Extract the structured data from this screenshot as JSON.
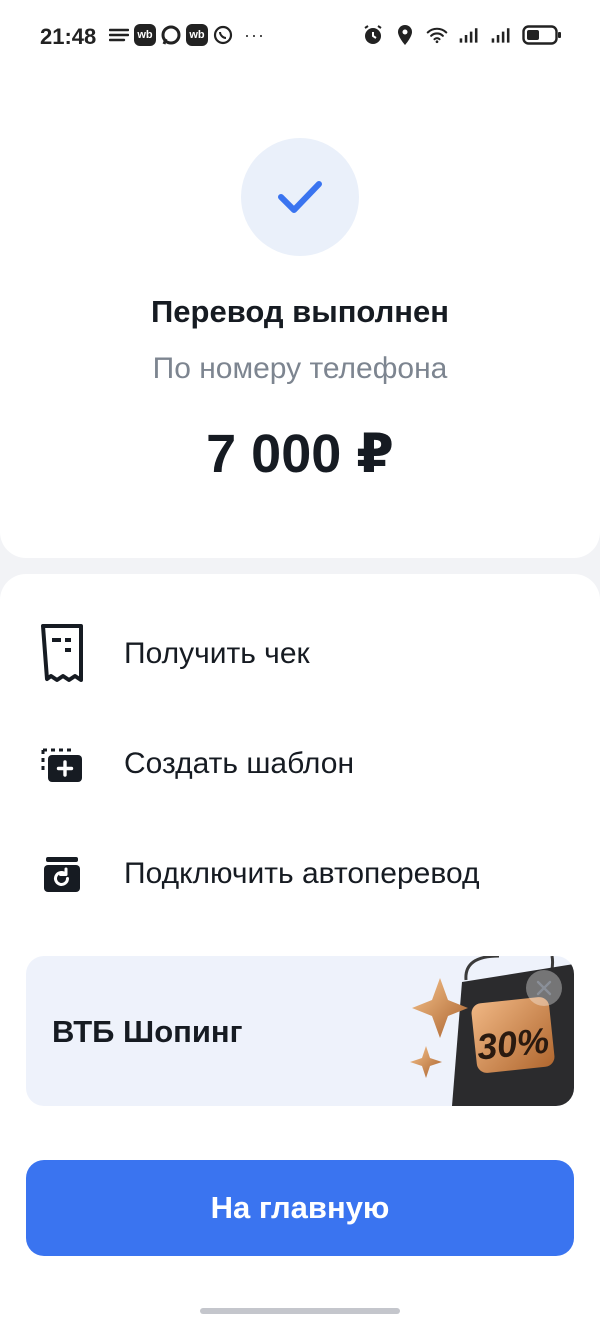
{
  "status_bar": {
    "time": "21:48",
    "left_icons": [
      "menu-lines-icon",
      "wb-icon",
      "chat-icon",
      "wb-icon",
      "whatsapp-icon"
    ],
    "wb_label": "wb",
    "more": "···",
    "right_icons": [
      "alarm-icon",
      "location-icon",
      "wifi-icon",
      "signal-icon",
      "signal-icon",
      "battery-icon"
    ]
  },
  "result": {
    "icon": "checkmark-icon",
    "title": "Перевод выполнен",
    "subtitle": "По номеру телефона",
    "amount": "7 000 ₽"
  },
  "actions": [
    {
      "label": "Получить чек",
      "icon": "receipt-icon"
    },
    {
      "label": "Создать шаблон",
      "icon": "template-add-icon"
    },
    {
      "label": "Подключить автоперевод",
      "icon": "auto-transfer-icon"
    }
  ],
  "promo": {
    "title": "ВТБ Шопинг",
    "badge_text": "30%",
    "close_icon": "close-icon"
  },
  "main_button": {
    "label": "На главную"
  },
  "colors": {
    "accent": "#3a74f0",
    "check": "#3a74f0",
    "check_bg": "#eaf0fa",
    "promo_bg": "#eef2fb",
    "subtitle": "#7d8590"
  }
}
